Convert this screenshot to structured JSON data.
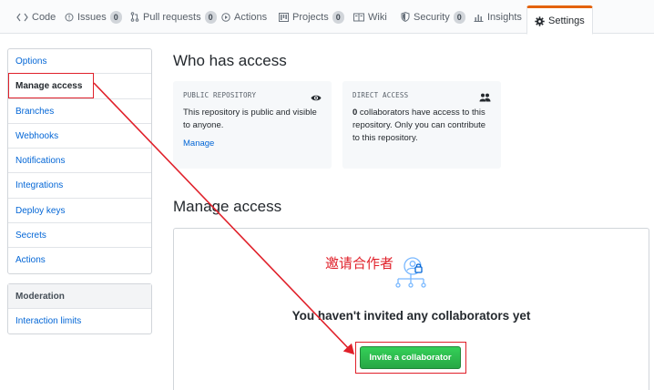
{
  "tabs": [
    {
      "label": "Code",
      "icon": "code-icon",
      "count": ""
    },
    {
      "label": "Issues",
      "icon": "issue-icon",
      "count": "0"
    },
    {
      "label": "Pull requests",
      "icon": "pull-request-icon",
      "count": "0"
    },
    {
      "label": "Actions",
      "icon": "play-icon",
      "count": ""
    },
    {
      "label": "Projects",
      "icon": "project-icon",
      "count": "0"
    },
    {
      "label": "Wiki",
      "icon": "book-icon",
      "count": ""
    },
    {
      "label": "Security",
      "icon": "shield-icon",
      "count": "0"
    },
    {
      "label": "Insights",
      "icon": "graph-icon",
      "count": ""
    },
    {
      "label": "Settings",
      "icon": "gear-icon",
      "count": "",
      "selected": true
    }
  ],
  "sidebar": {
    "items": [
      "Options",
      "Manage access",
      "Branches",
      "Webhooks",
      "Notifications",
      "Integrations",
      "Deploy keys",
      "Secrets",
      "Actions"
    ],
    "active": "Manage access",
    "moderation": {
      "heading": "Moderation",
      "items": [
        "Interaction limits"
      ]
    }
  },
  "main": {
    "who_title": "Who has access",
    "public_card": {
      "label": "PUBLIC REPOSITORY",
      "text": "This repository is public and visible to anyone.",
      "link": "Manage"
    },
    "direct_card": {
      "label": "DIRECT ACCESS",
      "count": "0",
      "text": " collaborators have access to this repository. Only you can contribute to this repository."
    },
    "manage_title": "Manage access",
    "blankslate_message": "You haven't invited any collaborators yet",
    "invite_button": "Invite a collaborator"
  },
  "annotation": {
    "text": "邀请合作者",
    "color": "#e0202a"
  },
  "colors": {
    "link": "#0366d6",
    "accent_tab": "#e36209",
    "button_green": "#2ea44f"
  }
}
